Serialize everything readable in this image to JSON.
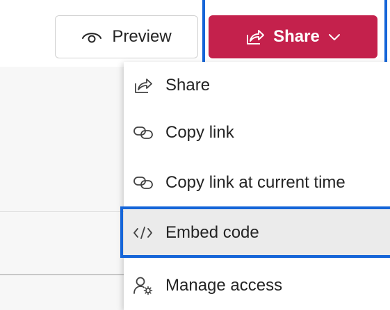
{
  "toolbar": {
    "preview_label": "Preview",
    "share_label": "Share"
  },
  "share_menu": {
    "items": [
      {
        "label": "Share",
        "icon": "share-icon",
        "selected": false
      },
      {
        "label": "Copy link",
        "icon": "link-icon",
        "selected": false
      },
      {
        "label": "Copy link at current time",
        "icon": "link-icon",
        "selected": false
      },
      {
        "label": "Embed code",
        "icon": "code-icon",
        "selected": true
      },
      {
        "label": "Manage access",
        "icon": "person-gear-icon",
        "selected": false
      }
    ]
  },
  "colors": {
    "share_button": "#c4214c",
    "highlight_outline": "#1565d8",
    "selected_item_bg": "#ebebeb"
  }
}
